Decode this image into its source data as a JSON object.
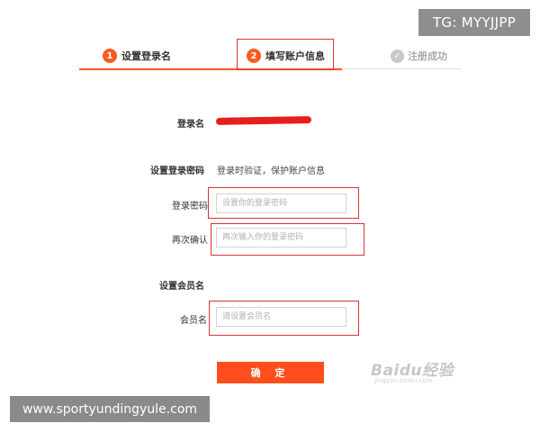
{
  "overlay_top": "TG: MYYJJPP",
  "steps": [
    {
      "number": "1",
      "label": "设置登录名"
    },
    {
      "number": "2",
      "label": "填写账户信息"
    },
    {
      "icon": "check-icon",
      "label": "注册成功"
    }
  ],
  "form": {
    "login_name_label": "登录名",
    "password_section_label": "设置登录密码",
    "password_hint": "登录时验证，保护账户信息",
    "password_label": "登录密码",
    "password_placeholder": "设置你的登录密码",
    "confirm_label": "再次确认",
    "confirm_placeholder": "再次输入你的登录密码",
    "member_section_label": "设置会员名",
    "member_label": "会员名",
    "member_placeholder": "请设置会员名",
    "submit_label": "确 定"
  },
  "watermark": {
    "main": "Baidu经验",
    "sub": "jingyan.baidu.com"
  },
  "overlay_bottom": "www.sportyundingyule.com",
  "colors": {
    "accent": "#ff5a1f",
    "highlight_box": "#d9323a",
    "redaction": "#e51e1e"
  }
}
